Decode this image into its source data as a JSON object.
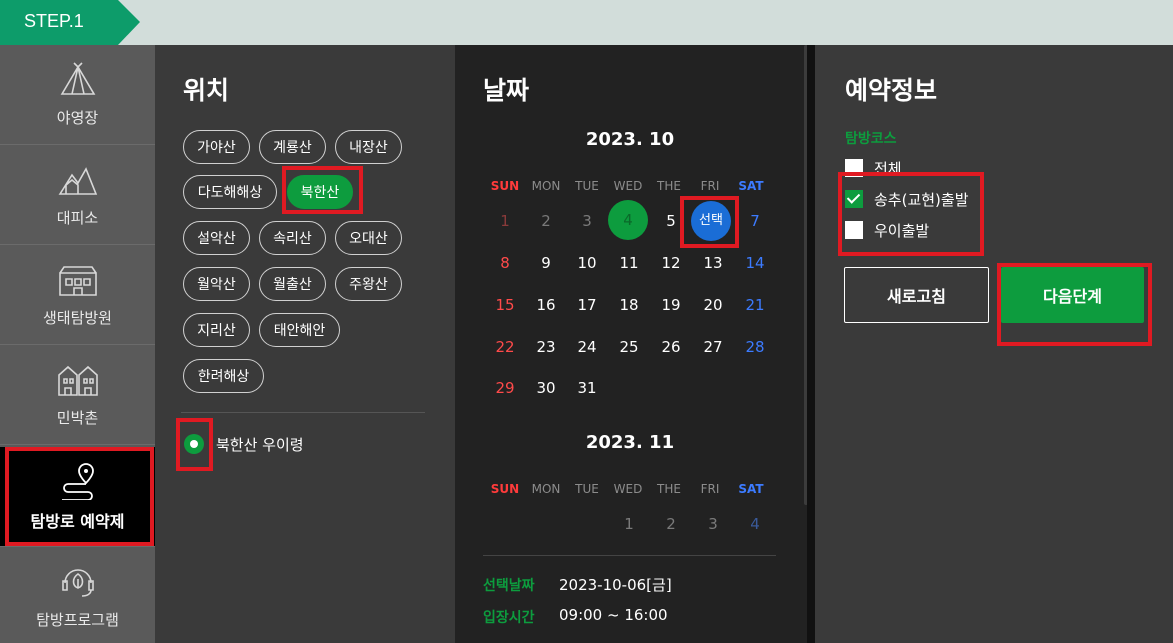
{
  "step": {
    "label": "STEP.1"
  },
  "sidebar": {
    "items": [
      {
        "label": "야영장",
        "icon": "tent-icon"
      },
      {
        "label": "대피소",
        "icon": "mountain-shelter-icon"
      },
      {
        "label": "생태탐방원",
        "icon": "building-icon"
      },
      {
        "label": "민박촌",
        "icon": "houses-icon"
      },
      {
        "label": "탐방로 예약제",
        "icon": "trail-pin-icon",
        "active": true
      },
      {
        "label": "탐방프로그램",
        "icon": "program-headset-icon"
      }
    ]
  },
  "location": {
    "title": "위치",
    "chips": [
      "가야산",
      "계룡산",
      "내장산",
      "다도해해상",
      "북한산",
      "설악산",
      "속리산",
      "오대산",
      "월악산",
      "월출산",
      "주왕산",
      "지리산",
      "태안해안",
      "한려해상"
    ],
    "selected_chip": "북한산",
    "trail_option": "북한산 우이령"
  },
  "date": {
    "title": "날짜",
    "weekdays": [
      "SUN",
      "MON",
      "TUE",
      "WED",
      "THE",
      "FRI",
      "SAT"
    ],
    "month1": {
      "title": "2023. 10",
      "rows": [
        [
          "1",
          "2",
          "3",
          "4",
          "5",
          "선택",
          "7"
        ],
        [
          "8",
          "9",
          "10",
          "11",
          "12",
          "13",
          "14"
        ],
        [
          "15",
          "16",
          "17",
          "18",
          "19",
          "20",
          "21"
        ],
        [
          "22",
          "23",
          "24",
          "25",
          "26",
          "27",
          "28"
        ],
        [
          "29",
          "30",
          "31",
          "",
          "",
          "",
          ""
        ]
      ]
    },
    "month2": {
      "title": "2023. 11",
      "rows": [
        [
          "",
          "",
          "",
          "1",
          "2",
          "3",
          "4"
        ]
      ]
    },
    "selected_date_label": "선택날짜",
    "selected_date_value": "2023-10-06[금]",
    "entry_time_label": "입장시간",
    "entry_time_value": "09:00 ~ 16:00"
  },
  "reservation": {
    "title": "예약정보",
    "course_label": "탐방코스",
    "options": [
      {
        "label": "전체",
        "checked": false
      },
      {
        "label": "송추(교현)출발",
        "checked": true
      },
      {
        "label": "우이출발",
        "checked": false
      }
    ],
    "refresh_label": "새로고침",
    "next_label": "다음단계"
  },
  "colors": {
    "accent": "#0d9c3e",
    "selected": "#1a6dd6",
    "highlight": "#e01a22"
  }
}
